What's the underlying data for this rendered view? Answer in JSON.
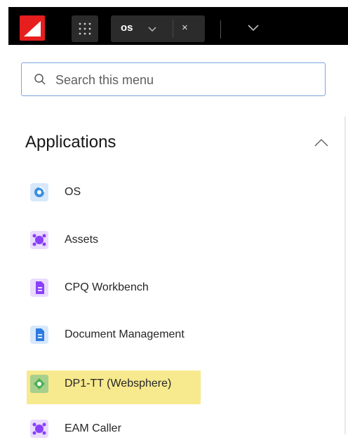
{
  "topbar": {
    "logo_icon": "red-wedge-logo",
    "apps_icon": "grid-icon",
    "active_tab": {
      "label": "os",
      "dropdown_icon": "chevron-down-icon",
      "close_glyph": "×"
    },
    "overflow_icon": "chevron-down-icon"
  },
  "search": {
    "placeholder": "Search this menu",
    "icon": "search-icon"
  },
  "section": {
    "title": "Applications",
    "collapse_icon": "chevron-up-icon"
  },
  "applications": [
    {
      "label": "OS",
      "icon": "os-app-icon",
      "color": "#3b8fe0"
    },
    {
      "label": "Assets",
      "icon": "assets-app-icon",
      "color": "#8a3ffc"
    },
    {
      "label": "CPQ Workbench",
      "icon": "cpq-app-icon",
      "color": "#8a3ffc"
    },
    {
      "label": "Document Management",
      "icon": "document-app-icon",
      "color": "#2d7be0"
    },
    {
      "label": "DP1-TT (Websphere)",
      "icon": "dp1-app-icon",
      "color": "#4caf50",
      "highlighted": true
    },
    {
      "label": "EAM Caller",
      "icon": "eam-app-icon",
      "color": "#8a3ffc"
    }
  ],
  "colors": {
    "topbar_bg": "#000000",
    "brand_red": "#e61e1e",
    "search_border": "#7aa6e0",
    "highlight": "#f7e98e"
  }
}
